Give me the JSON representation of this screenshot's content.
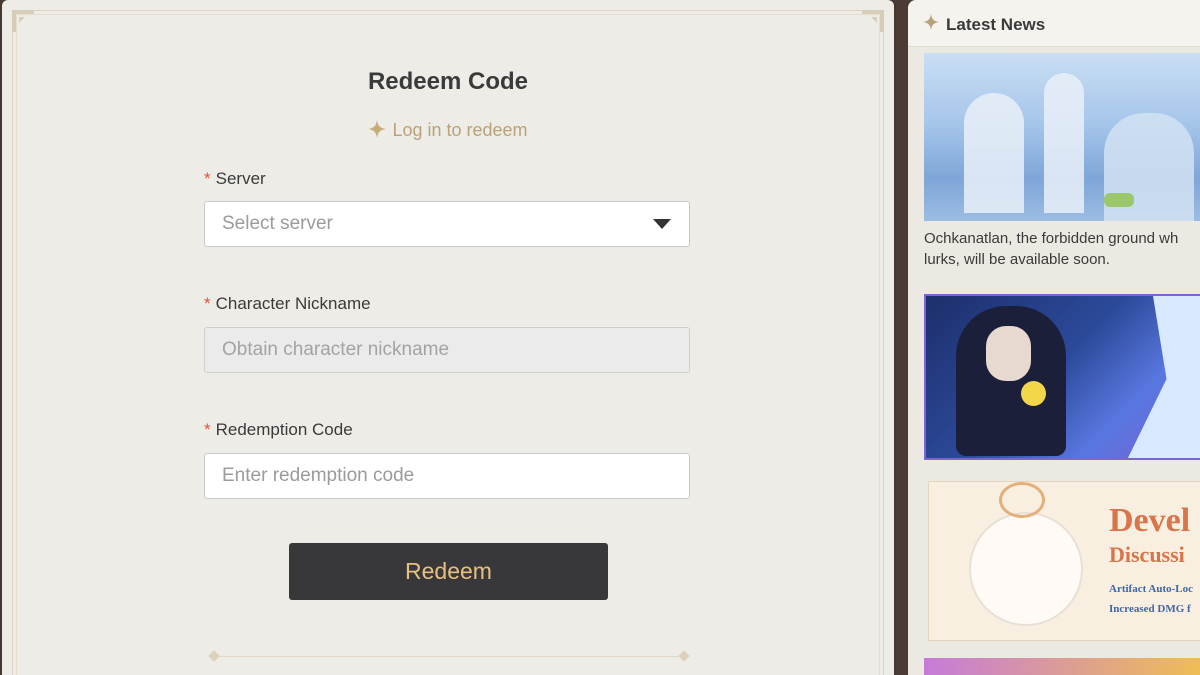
{
  "redeem": {
    "title": "Redeem Code",
    "login_prompt": "Log in to redeem",
    "server": {
      "label": "Server",
      "placeholder": "Select server"
    },
    "nickname": {
      "label": "Character Nickname",
      "placeholder": "Obtain character nickname"
    },
    "code": {
      "label": "Redemption Code",
      "placeholder": "Enter redemption code"
    },
    "required_mark": "*",
    "button_label": "Redeem"
  },
  "news": {
    "title": "Latest News",
    "items": [
      {
        "caption_line1": "Ochkanatlan, the forbidden ground wh",
        "caption_line2": "lurks, will be available soon."
      },
      {},
      {
        "banner_title1": "Devel",
        "banner_title2": "Discussi",
        "banner_line1": "Artifact Auto-Loc",
        "banner_line2": "Increased DMG f"
      },
      {}
    ]
  },
  "colors": {
    "accent_gold": "#e6c07f",
    "required_red": "#e2523b",
    "button_bg": "#38383a"
  }
}
